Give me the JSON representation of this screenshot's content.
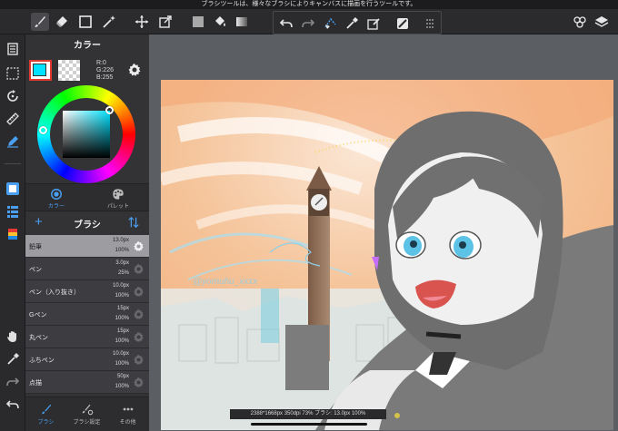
{
  "top_message": "ブラシツールは、様々なブラシによりキャンバスに描画を行うツールです。",
  "toolbar": {
    "icons": [
      "brush-icon",
      "eraser-icon",
      "rect-select-icon",
      "magic-wand-icon",
      "move-icon",
      "transform-icon",
      "fill-color-icon",
      "bucket-icon",
      "gradient-icon",
      "shapes-icon",
      "layers-icon"
    ],
    "active": "brush-icon"
  },
  "subbar": {
    "icons": [
      "undo-icon",
      "redo-icon",
      "lasso-fill-icon",
      "eyedropper-icon",
      "edit-select-icon",
      "snap-icon",
      "grip-icon"
    ]
  },
  "left_tools": {
    "icons": [
      "menu-icon",
      "selection-icon",
      "rotate-icon",
      "ruler-icon",
      "pen-icon",
      "color-swatch-icon",
      "layers-list-icon",
      "material-icon",
      "hand-icon",
      "dropper-icon",
      "redo-icon",
      "undo-icon"
    ]
  },
  "color_panel": {
    "title": "カラー",
    "r": "R:0",
    "g": "G:226",
    "b": "B:255",
    "current_color": "#00e2ff",
    "tabs": [
      {
        "label": "カラー"
      },
      {
        "label": "パレット"
      }
    ]
  },
  "brush_panel": {
    "title": "ブラシ",
    "brushes": [
      {
        "name": "鉛筆",
        "size": "13.0px",
        "opacity": "100%",
        "selected": true
      },
      {
        "name": "ペン",
        "size": "3.0px",
        "opacity": "25%",
        "selected": false
      },
      {
        "name": "ペン（入り抜き）",
        "size": "10.0px",
        "opacity": "100%",
        "selected": false
      },
      {
        "name": "Gペン",
        "size": "15px",
        "opacity": "100%",
        "selected": false
      },
      {
        "name": "丸ペン",
        "size": "15px",
        "opacity": "100%",
        "selected": false
      },
      {
        "name": "ふちペン",
        "size": "10.0px",
        "opacity": "100%",
        "selected": false
      },
      {
        "name": "点描",
        "size": "50px",
        "opacity": "100%",
        "selected": false
      }
    ],
    "tabs": [
      {
        "label": "ブラシ"
      },
      {
        "label": "ブラシ設定"
      },
      {
        "label": "その他"
      }
    ]
  },
  "status_bar": "2388*1668px 350dpi 73% ブラシ: 13.0px 100%"
}
